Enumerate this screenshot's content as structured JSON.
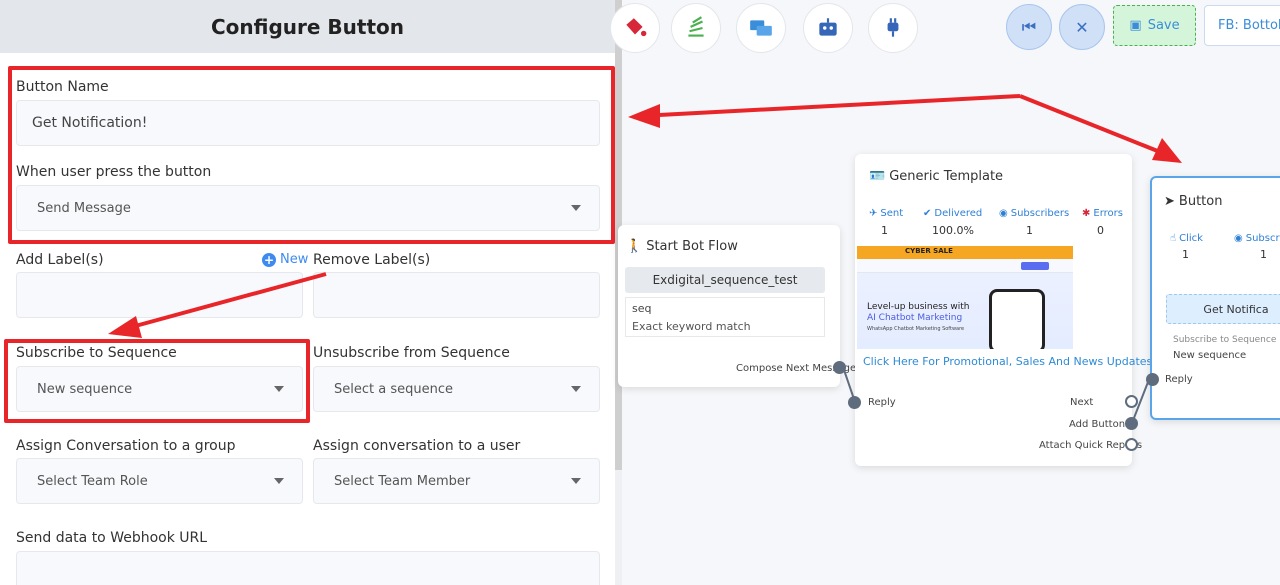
{
  "panel": {
    "title": "Configure Button",
    "button_name": {
      "label": "Button Name",
      "value": "Get Notification!"
    },
    "press_action": {
      "label": "When user press the button",
      "value": "Send Message"
    },
    "add_labels": {
      "label": "Add Label(s)",
      "new_link": "New",
      "value": ""
    },
    "remove_labels": {
      "label": "Remove Label(s)",
      "value": ""
    },
    "subscribe_sequence": {
      "label": "Subscribe to Sequence",
      "value": "New sequence"
    },
    "unsubscribe_sequence": {
      "label": "Unsubscribe from Sequence",
      "value": "Select a sequence"
    },
    "assign_group": {
      "label": "Assign Conversation to a group",
      "value": "Select Team Role"
    },
    "assign_user": {
      "label": "Assign conversation to a user",
      "value": "Select Team Member"
    },
    "webhook": {
      "label": "Send data to Webhook URL",
      "value": ""
    }
  },
  "toolbar": {
    "icons": [
      "paint-bucket-icon",
      "stack-icon",
      "messages-icon",
      "robot-icon",
      "plug-icon"
    ],
    "save_label": "Save",
    "fb_label": "FB: Bottola"
  },
  "nodes": {
    "start_bot_flow": {
      "title": "Start Bot Flow",
      "keyword": "Exdigital_sequence_test",
      "seq": "seq",
      "match": "Exact keyword match",
      "out_port": "Compose Next Message"
    },
    "generic_template": {
      "title": "Generic Template",
      "stats": [
        {
          "label": "Sent",
          "value": "1"
        },
        {
          "label": "Delivered",
          "value": "100.0%"
        },
        {
          "label": "Subscribers",
          "value": "1"
        },
        {
          "label": "Errors",
          "value": "0"
        }
      ],
      "banner": {
        "top": "CYBER SALE",
        "headline": "Level-up business with",
        "subheadline": "AI Chatbot Marketing",
        "tagline": "WhatsApp Chatbot Marketing Software"
      },
      "caption": "Click Here For Promotional, Sales And News Updates.",
      "in_port": "Reply",
      "ports": [
        "Next",
        "Add Buttons",
        "Attach Quick Replies"
      ]
    },
    "button": {
      "title": "Button",
      "stats": [
        {
          "label": "Click",
          "value": "1"
        },
        {
          "label": "Subscri",
          "value": "1"
        }
      ],
      "button_label": "Get Notifica",
      "sub_label": "Subscribe to Sequence",
      "sub_value": "New sequence",
      "in_port": "Reply"
    }
  },
  "colors": {
    "highlight": "#e8262a",
    "accent": "#3d8bf0",
    "save_bg": "#d5f5db"
  }
}
